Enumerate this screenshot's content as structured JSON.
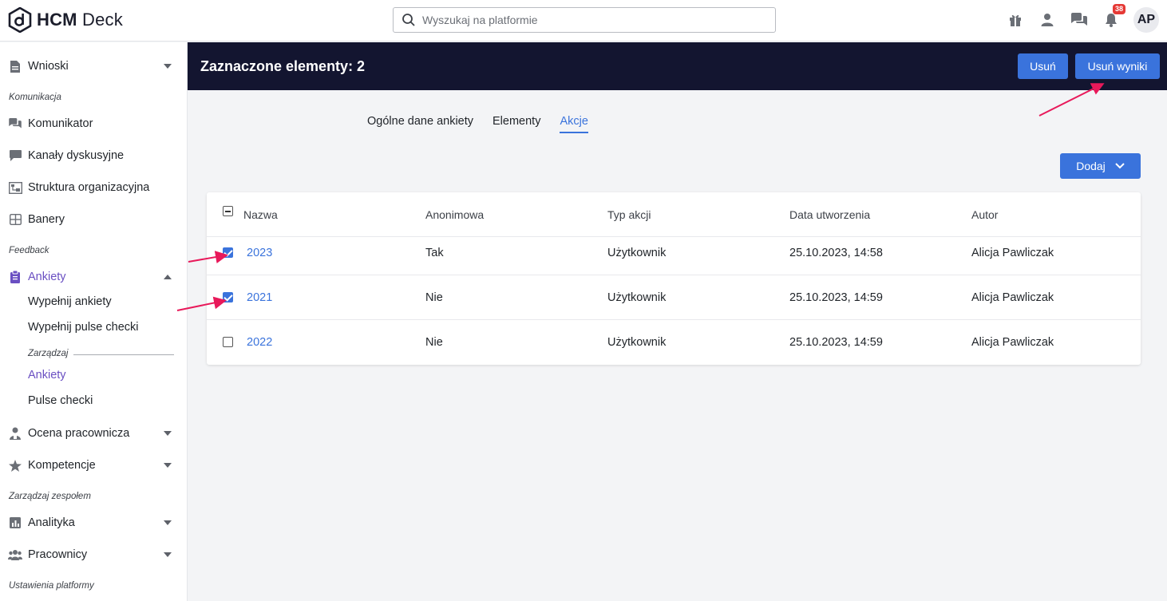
{
  "app": {
    "logo_bold": "HCM",
    "logo_light": " Deck"
  },
  "search": {
    "placeholder": "Wyszukaj na platformie"
  },
  "header_icons": {
    "icons": [
      "gift-icon",
      "user-icon",
      "chat-icon",
      "bell-icon"
    ],
    "notification_count": "38",
    "avatar_initials": "AP"
  },
  "sidebar": {
    "wnioski": "Wnioski",
    "section_komunikacja": "Komunikacja",
    "komunikator": "Komunikator",
    "kanaly": "Kanały dyskusyjne",
    "struktura": "Struktura organizacyjna",
    "banery": "Banery",
    "section_feedback": "Feedback",
    "ankiety": "Ankiety",
    "wypelnij_ankiety": "Wypełnij ankiety",
    "wypelnij_pulse": "Wypełnij pulse checki",
    "sub_zarzadzaj": "Zarządzaj",
    "ankiety_sub": "Ankiety",
    "pulse_checki": "Pulse checki",
    "ocena": "Ocena pracownicza",
    "kompetencje": "Kompetencje",
    "section_zespol": "Zarządzaj zespołem",
    "analityka": "Analityka",
    "pracownicy": "Pracownicy",
    "section_ustawienia": "Ustawienia platformy"
  },
  "selection_bar": {
    "title": "Zaznaczone elementy: 2",
    "delete_label": "Usuń",
    "delete_results_label": "Usuń wyniki"
  },
  "tabs": [
    "Ogólne dane ankiety",
    "Elementy",
    "Akcje"
  ],
  "active_tab": "Akcje",
  "add_button": {
    "label": "Dodaj"
  },
  "table": {
    "headers": [
      "Nazwa",
      "Anonimowa",
      "Typ akcji",
      "Data utworzenia",
      "Autor"
    ],
    "rows": [
      {
        "checked": true,
        "name": "2023",
        "anonymous": "Tak",
        "type": "Użytkownik",
        "created": "25.10.2023, 14:58",
        "author": "Alicja Pawliczak"
      },
      {
        "checked": true,
        "name": "2021",
        "anonymous": "Nie",
        "type": "Użytkownik",
        "created": "25.10.2023, 14:59",
        "author": "Alicja Pawliczak"
      },
      {
        "checked": false,
        "name": "2022",
        "anonymous": "Nie",
        "type": "Użytkownik",
        "created": "25.10.2023, 14:59",
        "author": "Alicja Pawliczak"
      }
    ]
  },
  "colors": {
    "accent": "#3a73dc",
    "dark_bar": "#131530",
    "active_nav": "#6a4fc2",
    "annotation_arrow": "#e8195a"
  }
}
